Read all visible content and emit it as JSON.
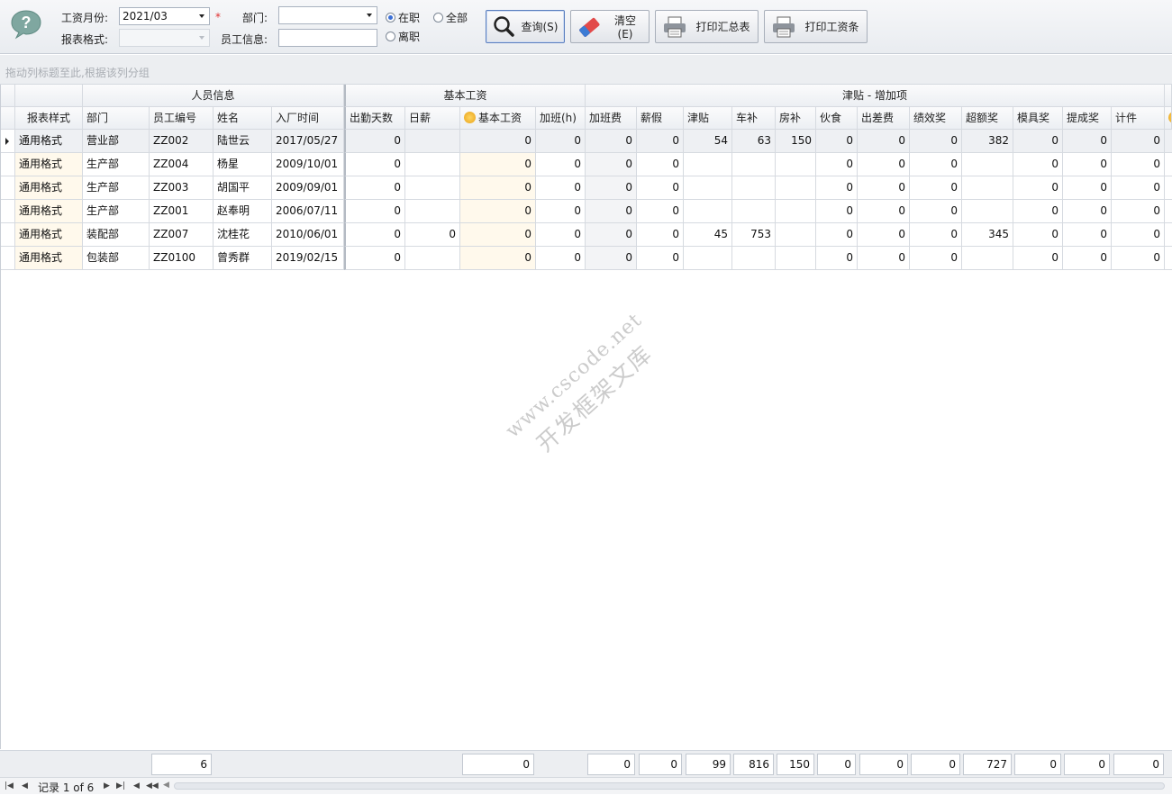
{
  "toolbar": {
    "month_label": "工资月份:",
    "month_value": "2021/03",
    "required_mark": "*",
    "dept_label": "部门:",
    "dept_value": "",
    "format_label": "报表格式:",
    "format_value": "",
    "employee_label": "员工信息:",
    "employee_value": "",
    "radio_active": "在职",
    "radio_all": "全部",
    "radio_left": "离职",
    "query_label": "查询(S)",
    "clear_label": "清空(E)",
    "print_summary_label": "打印汇总表",
    "print_slip_label": "打印工资条"
  },
  "group_hint": "拖动列标题至此,根据该列分组",
  "bands": {
    "personnel": "人员信息",
    "base_salary": "基本工资",
    "allowance": "津贴 - 增加项"
  },
  "columns": [
    "报表样式",
    "部门",
    "员工编号",
    "姓名",
    "入厂时间",
    "出勤天数",
    "日薪",
    "基本工资",
    "加班(h)",
    "加班费",
    "薪假",
    "津贴",
    "车补",
    "房补",
    "伙食",
    "出差费",
    "绩效奖",
    "超额奖",
    "模具奖",
    "提成奖",
    "计件"
  ],
  "rows": [
    {
      "c": [
        "通用格式",
        "营业部",
        "ZZ002",
        "陆世云",
        "2017/05/27",
        "0",
        "",
        "0",
        "0",
        "0",
        "0",
        "54",
        "63",
        "150",
        "0",
        "0",
        "0",
        "382",
        "0",
        "0",
        "0"
      ]
    },
    {
      "c": [
        "通用格式",
        "生产部",
        "ZZ004",
        "杨星",
        "2009/10/01",
        "0",
        "",
        "0",
        "0",
        "0",
        "0",
        "",
        "",
        "",
        "0",
        "0",
        "0",
        "",
        "0",
        "0",
        "0"
      ]
    },
    {
      "c": [
        "通用格式",
        "生产部",
        "ZZ003",
        "胡国平",
        "2009/09/01",
        "0",
        "",
        "0",
        "0",
        "0",
        "0",
        "",
        "",
        "",
        "0",
        "0",
        "0",
        "",
        "0",
        "0",
        "0"
      ]
    },
    {
      "c": [
        "通用格式",
        "生产部",
        "ZZ001",
        "赵奉明",
        "2006/07/11",
        "0",
        "",
        "0",
        "0",
        "0",
        "0",
        "",
        "",
        "",
        "0",
        "0",
        "0",
        "",
        "0",
        "0",
        "0"
      ]
    },
    {
      "c": [
        "通用格式",
        "装配部",
        "ZZ007",
        "沈桂花",
        "2010/06/01",
        "0",
        "0",
        "0",
        "0",
        "0",
        "0",
        "45",
        "753",
        "",
        "0",
        "0",
        "0",
        "345",
        "0",
        "0",
        "0"
      ]
    },
    {
      "c": [
        "通用格式",
        "包装部",
        "ZZ0100",
        "曾秀群",
        "2019/02/15",
        "0",
        "",
        "0",
        "0",
        "0",
        "0",
        "",
        "",
        "",
        "0",
        "0",
        "0",
        "",
        "0",
        "0",
        "0"
      ]
    }
  ],
  "footer": {
    "count": "6",
    "base_salary_total": "0",
    "overtime_pay_total": "0",
    "paid_leave_total": "0",
    "allowance_total": "99",
    "car_total": "816",
    "housing_total": "150",
    "meal_total": "0",
    "travel_total": "0",
    "performance_total": "0",
    "excess_total": "727",
    "mold_total": "0",
    "commission_total": "0",
    "piece_total": "0"
  },
  "navigator": {
    "record_text": "记录 1 of 6"
  },
  "watermark": {
    "line1": "www.cscode.net",
    "line2": "开发框架文库"
  }
}
